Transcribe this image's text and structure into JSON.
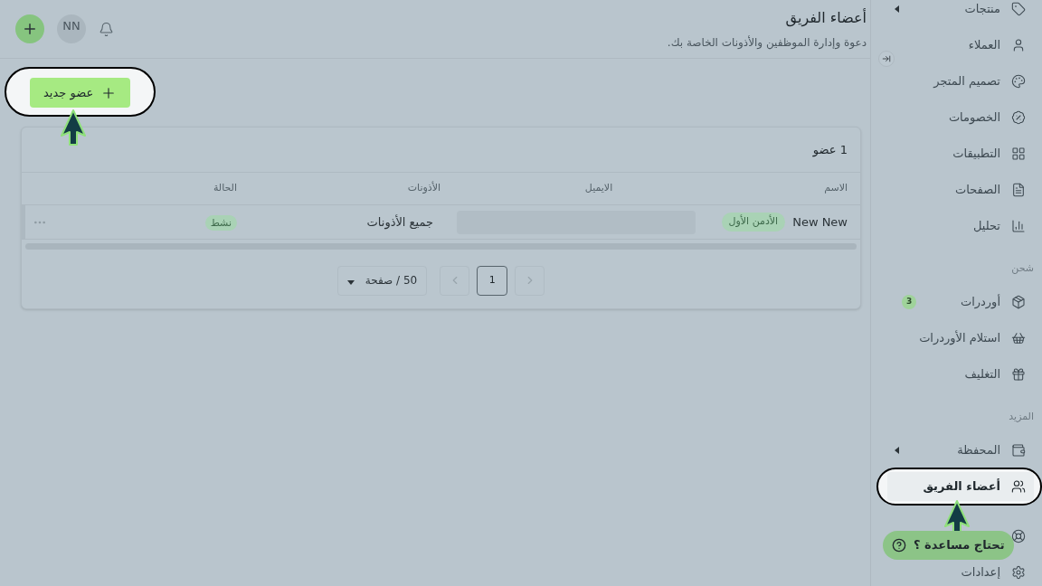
{
  "header": {
    "title": "أعضاء الفريق",
    "subtitle": "دعوة وإدارة الموظفين والأذونات الخاصة بك.",
    "avatar": "NN"
  },
  "new_member_button": {
    "label": "عضو جديد",
    "highlighted": true
  },
  "members_card": {
    "count": "1 عضو",
    "columns": [
      "الاسم",
      "الايميل",
      "الأذونات",
      "الحالة"
    ],
    "rows": [
      {
        "name": "New New",
        "role": "الأدمن الأول",
        "permissions": "جميع الأذونات",
        "status": "نشط"
      }
    ],
    "pagination": {
      "pages": [
        {
          "label": "1",
          "selected": true
        }
      ],
      "page_size": "50 / صفحة"
    }
  },
  "sidebar": {
    "items": [
      {
        "kind": "item",
        "label": "منتجات",
        "expandable": true,
        "selected": false
      },
      {
        "kind": "item",
        "label": "العملاء",
        "expandable": false,
        "selected": false
      },
      {
        "kind": "item",
        "label": "تصميم المتجر",
        "expandable": false,
        "selected": false
      },
      {
        "kind": "item",
        "label": "الخصومات",
        "expandable": false,
        "selected": false
      },
      {
        "kind": "item",
        "label": "التطبيقات",
        "expandable": false,
        "selected": false
      },
      {
        "kind": "item",
        "label": "الصفحات",
        "expandable": false,
        "selected": false
      },
      {
        "kind": "item",
        "label": "تحليل",
        "expandable": false,
        "selected": false
      },
      {
        "kind": "heading",
        "label": "شحن"
      },
      {
        "kind": "item",
        "label": "أوردرات",
        "badge": "3",
        "expandable": false,
        "selected": false
      },
      {
        "kind": "item",
        "label": "استلام الأوردرات",
        "expandable": false,
        "selected": false
      },
      {
        "kind": "item",
        "label": "التغليف",
        "expandable": false,
        "selected": false
      },
      {
        "kind": "heading",
        "label": "المزيد"
      },
      {
        "kind": "item",
        "label": "المحفظة",
        "expandable": true,
        "selected": false
      },
      {
        "kind": "item",
        "label": "أعضاء الفريق",
        "expandable": false,
        "selected": true
      },
      {
        "kind": "item"
      },
      {
        "kind": "item",
        "label": "إعدادات",
        "expandable": false,
        "selected": false
      }
    ]
  },
  "help_button": {
    "label": "تحتاج مساعدة ؟"
  }
}
